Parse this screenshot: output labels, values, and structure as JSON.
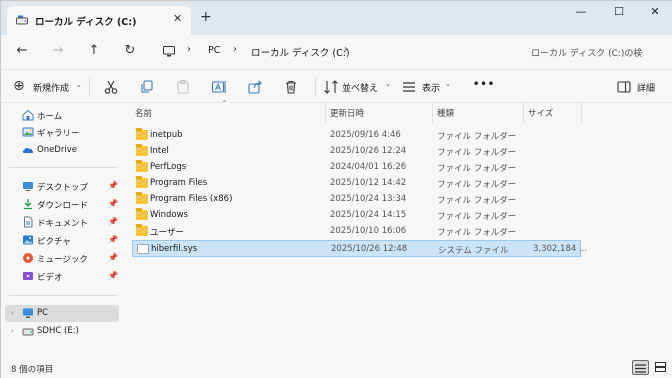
{
  "tab": {
    "title": "ローカル ディスク (C:)",
    "close": "✕",
    "new": "+"
  },
  "window_controls": {
    "minimize": "—",
    "maximize": "☐",
    "close": "✕"
  },
  "nav": {
    "back": "←",
    "forward": "→",
    "up": "↑",
    "refresh": "↻"
  },
  "address": {
    "segments": [
      "PC",
      "ローカル ディスク (C:)"
    ],
    "chevron": "›"
  },
  "search": {
    "placeholder": "ローカル ディスク (C:)の検"
  },
  "toolbar": {
    "new_label": "新規作成",
    "sort_label": "並べ替え",
    "view_label": "表示",
    "more": "•••",
    "details_label": "詳細"
  },
  "sidebar": {
    "items": [
      {
        "label": "ホーム",
        "icon": "home-icon",
        "pinned": false
      },
      {
        "label": "ギャラリー",
        "icon": "gallery-icon",
        "pinned": false
      },
      {
        "label": "OneDrive",
        "icon": "onedrive-icon",
        "pinned": false
      },
      {
        "label": "デスクトップ",
        "icon": "desktop-icon",
        "pinned": true
      },
      {
        "label": "ダウンロード",
        "icon": "download-icon",
        "pinned": true
      },
      {
        "label": "ドキュメント",
        "icon": "document-icon",
        "pinned": true
      },
      {
        "label": "ピクチャ",
        "icon": "picture-icon",
        "pinned": true
      },
      {
        "label": "ミュージック",
        "icon": "music-icon",
        "pinned": true
      },
      {
        "label": "ビデオ",
        "icon": "video-icon",
        "pinned": true
      },
      {
        "label": "PC",
        "icon": "pc-icon",
        "pinned": false
      },
      {
        "label": "SDHC (E:)",
        "icon": "drive-icon",
        "pinned": false
      }
    ]
  },
  "columns": {
    "name": "名前",
    "date": "更新日時",
    "type": "種類",
    "size": "サイズ"
  },
  "files": [
    {
      "name": "inetpub",
      "date": "2025/09/16 4:46",
      "type": "ファイル フォルダー",
      "size": "",
      "kind": "folder"
    },
    {
      "name": "Intel",
      "date": "2025/10/26 12:24",
      "type": "ファイル フォルダー",
      "size": "",
      "kind": "folder"
    },
    {
      "name": "PerfLogs",
      "date": "2024/04/01 16:26",
      "type": "ファイル フォルダー",
      "size": "",
      "kind": "folder"
    },
    {
      "name": "Program Files",
      "date": "2025/10/12 14:42",
      "type": "ファイル フォルダー",
      "size": "",
      "kind": "folder"
    },
    {
      "name": "Program Files (x86)",
      "date": "2025/10/24 13:34",
      "type": "ファイル フォルダー",
      "size": "",
      "kind": "folder"
    },
    {
      "name": "Windows",
      "date": "2025/10/24 14:15",
      "type": "ファイル フォルダー",
      "size": "",
      "kind": "folder"
    },
    {
      "name": "ユーザー",
      "date": "2025/10/10 16:06",
      "type": "ファイル フォルダー",
      "size": "",
      "kind": "folder"
    },
    {
      "name": "hiberfil.sys",
      "date": "2025/10/26 12:48",
      "type": "システム ファイル",
      "size": "3,302,184 ...",
      "kind": "file"
    }
  ],
  "status": {
    "count": "8 個の項目"
  },
  "colors": {
    "selection": "#cce4f7",
    "selection_border": "#99c9ef",
    "folder": "#f5c542"
  }
}
